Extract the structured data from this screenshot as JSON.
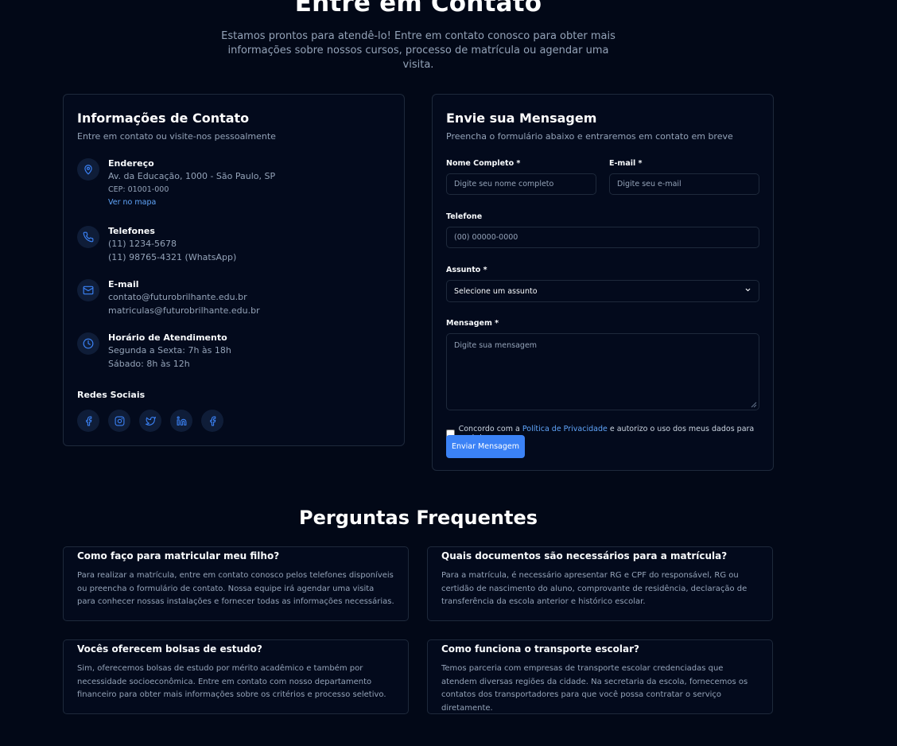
{
  "hero": {
    "title": "Entre em Contato",
    "subtitle": "Estamos prontos para atendê-lo! Entre em contato conosco para obter mais informações sobre nossos cursos, processo de matrícula ou agendar uma visita."
  },
  "contact_info": {
    "title": "Informações de Contato",
    "subtitle": "Entre em contato ou visite-nos pessoalmente",
    "address": {
      "label": "Endereço",
      "line1": "Av. da Educação, 1000 - São Paulo, SP",
      "cep": "CEP: 01001-000",
      "map_link": "Ver no mapa"
    },
    "phones": {
      "label": "Telefones",
      "line1": "(11) 1234-5678",
      "line2": "(11) 98765-4321 (WhatsApp)"
    },
    "email": {
      "label": "E-mail",
      "line1": "contato@futurobrilhante.edu.br",
      "line2": "matriculas@futurobrilhante.edu.br"
    },
    "hours": {
      "label": "Horário de Atendimento",
      "line1": "Segunda a Sexta: 7h às 18h",
      "line2": "Sábado: 8h às 12h"
    },
    "social_title": "Redes Sociais",
    "social_icons": [
      "facebook-icon",
      "instagram-icon",
      "twitter-icon",
      "linkedin-icon",
      "facebook-icon"
    ]
  },
  "form": {
    "title": "Envie sua Mensagem",
    "subtitle": "Preencha o formulário abaixo e entraremos em contato em breve",
    "name_label": "Nome Completo *",
    "name_placeholder": "Digite seu nome completo",
    "email_label": "E-mail *",
    "email_placeholder": "Digite seu e-mail",
    "phone_label": "Telefone",
    "phone_placeholder": "(00) 00000-0000",
    "subject_label": "Assunto *",
    "subject_selected": "Selecione um assunto",
    "message_label": "Mensagem *",
    "message_placeholder": "Digite sua mensagem",
    "consent_prefix": "Concordo com a",
    "consent_link": "Política de Privacidade",
    "consent_suffix": "e autorizo o uso dos meus dados para contato.",
    "submit_label": "Enviar Mensagem"
  },
  "faq": {
    "title": "Perguntas Frequentes",
    "items": [
      {
        "question": "Como faço para matricular meu filho?",
        "answer": "Para realizar a matrícula, entre em contato conosco pelos telefones disponíveis ou preencha o formulário de contato. Nossa equipe irá agendar uma visita para conhecer nossas instalações e fornecer todas as informações necessárias."
      },
      {
        "question": "Quais documentos são necessários para a matrícula?",
        "answer": "Para a matrícula, é necessário apresentar RG e CPF do responsável, RG ou certidão de nascimento do aluno, comprovante de residência, declaração de transferência da escola anterior e histórico escolar."
      },
      {
        "question": "Vocês oferecem bolsas de estudo?",
        "answer": "Sim, oferecemos bolsas de estudo por mérito acadêmico e também por necessidade socioeconômica. Entre em contato com nosso departamento financeiro para obter mais informações sobre os critérios e processo seletivo."
      },
      {
        "question": "Como funciona o transporte escolar?",
        "answer": "Temos parceria com empresas de transporte escolar credenciadas que atendem diversas regiões da cidade. Na secretaria da escola, fornecemos os contatos dos transportadores para que você possa contratar o serviço diretamente."
      }
    ]
  },
  "colors": {
    "background": "#020817",
    "card": "#030a1c",
    "border": "#1e293b",
    "accent": "#3b82f6",
    "link": "#60a5fa",
    "muted_text": "#94a3b8"
  }
}
